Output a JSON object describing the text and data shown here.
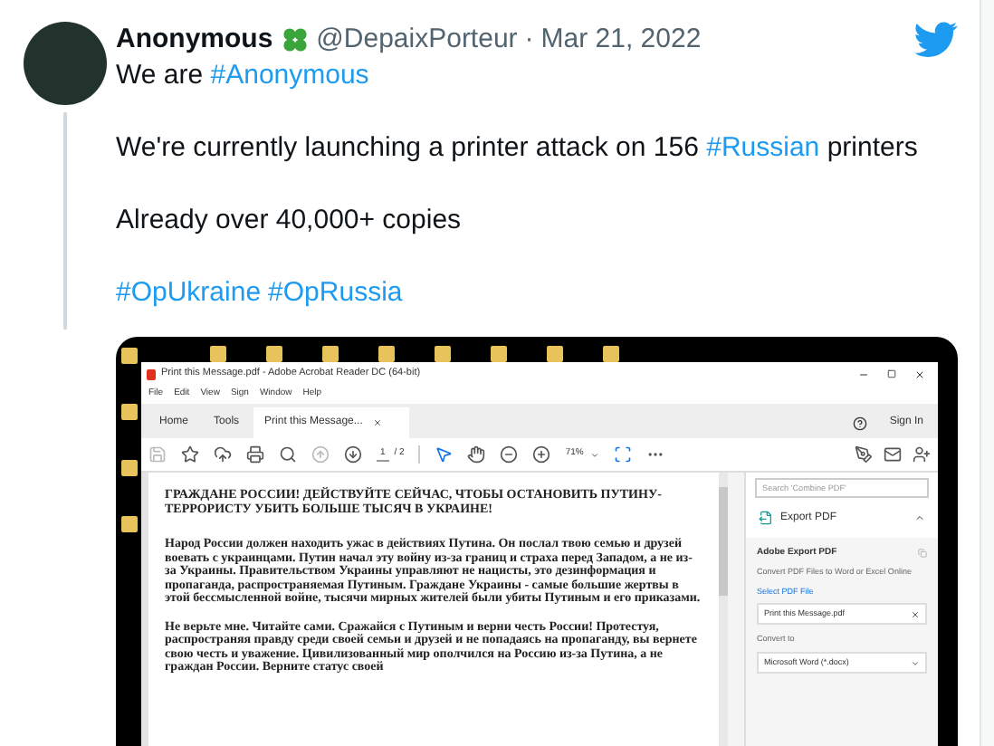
{
  "tweet": {
    "author": "Anonymous",
    "handle": "@DepaixPorteur",
    "separator": "·",
    "date": "Mar 21, 2022",
    "paragraphs": [
      [
        {
          "kind": "plain",
          "text": "We are "
        },
        {
          "kind": "hashtag",
          "text": "#Anonymous"
        }
      ],
      [
        {
          "kind": "plain",
          "text": "We're currently launching a printer attack on 156 "
        },
        {
          "kind": "hashtag",
          "text": "#Russian"
        },
        {
          "kind": "plain",
          "text": " printers"
        }
      ],
      [
        {
          "kind": "plain",
          "text": "Already over 40,000+ copies"
        }
      ],
      [
        {
          "kind": "hashtag",
          "text": "#OpUkraine"
        },
        {
          "kind": "hashtag",
          "text": "#OpRussia"
        }
      ]
    ]
  },
  "acrobat": {
    "title": "Print this Message.pdf - Adobe Acrobat Reader DC (64-bit)",
    "menu": [
      "File",
      "Edit",
      "View",
      "Sign",
      "Window",
      "Help"
    ],
    "tabs": [
      {
        "label": "Home",
        "selected": false
      },
      {
        "label": "Tools",
        "selected": false
      },
      {
        "label": "Print this Message...",
        "selected": true
      }
    ],
    "sign_in": "Sign In",
    "page_number": "1",
    "page_total": "/ 2",
    "zoom": "71%",
    "document": {
      "heading": "ГРАЖДАНЕ РОССИИ! ДЕЙСТВУЙТЕ СЕЙЧАС, ЧТОБЫ ОСТАНОВИТЬ ПУТИНУ-ТЕРРОРИСТУ УБИТЬ БОЛЬШЕ ТЫСЯЧ В УКРАИНЕ!",
      "paragraphs": [
        "Народ России должен находить ужас в действиях Путина. Он послал твою семью и друзей воевать с украинцами. Путин начал эту войну из-за границ и страха перед Западом, а не из-за Украины. Правительством Украины управляют не нацисты, это дезинформация и пропаганда, распространяемая Путиным. Граждане Украины - самые большие жертвы в этой бессмысленной войне, тысячи мирных жителей были убиты Путиным и его приказами.",
        "Не верьте мне. Читайте сами. Сражайся с Путиным и верни честь России! Протестуя, распространяя правду среди своей семьи и друзей и не попадаясь на пропаганду, вы вернете свою честь и уважение. Цивилизованный мир ополчился на Россию из-за Путина, а не граждан России. Верните статус своей"
      ]
    },
    "pane": {
      "search_placeholder": "Search 'Combine PDF'",
      "tool": "Export PDF",
      "expanded": true,
      "panel_title": "Adobe Export PDF",
      "description": "Convert PDF Files to Word or Excel Online",
      "select_link": "Select PDF File",
      "file": "Print this Message.pdf",
      "convert_label": "Convert to",
      "format": "Microsoft Word (*.docx)"
    }
  }
}
